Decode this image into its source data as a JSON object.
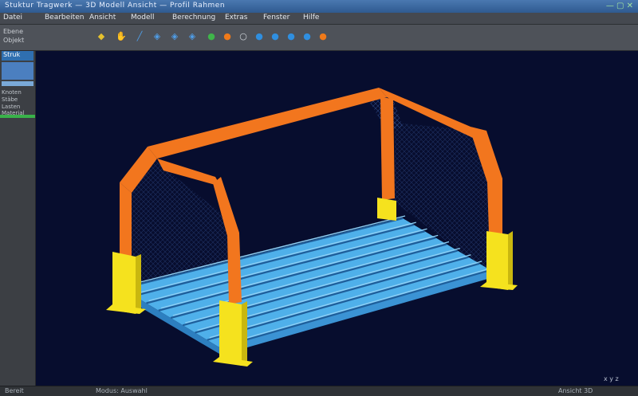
{
  "app": {
    "title": "Stuktur Tragwerk — 3D Modell Ansicht — Profil Rahmen",
    "window_controls": "— ▢ ✕"
  },
  "menu": [
    "Datei",
    "Bearbeiten",
    "Ansicht",
    "Modell",
    "Berechnung",
    "Extras",
    "Fenster",
    "Hilfe"
  ],
  "toolbar": {
    "left_labels": [
      "Ebene",
      "Objekt"
    ],
    "icons": [
      {
        "name": "select-icon",
        "glyph": "◆",
        "color": "#e6c22e"
      },
      {
        "name": "hand-icon",
        "glyph": "✋",
        "color": "#d9d9d9"
      },
      {
        "name": "line-icon",
        "glyph": "╱",
        "color": "#4f9ee8"
      },
      {
        "name": "view-front-icon",
        "glyph": "◈",
        "color": "#4f9ee8"
      },
      {
        "name": "view-side-icon",
        "glyph": "◈",
        "color": "#4f9ee8"
      },
      {
        "name": "view-iso-icon",
        "glyph": "◈",
        "color": "#4f9ee8"
      },
      {
        "name": "run-icon",
        "glyph": "●",
        "color": "#3fb54a"
      },
      {
        "name": "stop-icon",
        "glyph": "●",
        "color": "#f07a1a"
      },
      {
        "name": "pause-icon",
        "glyph": "○",
        "color": "#cfd4da"
      },
      {
        "name": "refresh-icon",
        "glyph": "●",
        "color": "#2f8fe0"
      },
      {
        "name": "zoom-icon",
        "glyph": "●",
        "color": "#2f8fe0"
      },
      {
        "name": "fit-icon",
        "glyph": "●",
        "color": "#2f8fe0"
      },
      {
        "name": "rotate-icon",
        "glyph": "●",
        "color": "#2f8fe0"
      },
      {
        "name": "record-icon",
        "glyph": "●",
        "color": "#f07a1a"
      }
    ]
  },
  "sidebar": {
    "header": "Struk",
    "rows": [
      "Knoten",
      "Stäbe",
      "Lasten",
      "Material"
    ]
  },
  "viewport": {
    "axis_label": "x y z"
  },
  "status": {
    "left": "Bereit",
    "mid": "Modus: Auswahl",
    "right": "Ansicht 3D"
  },
  "colors": {
    "viewport_bg": "#070d2e",
    "frame": "#f2761e",
    "posts": "#f5e21e",
    "deck": "#4fb0ea",
    "mesh": "#3a5aa0"
  }
}
